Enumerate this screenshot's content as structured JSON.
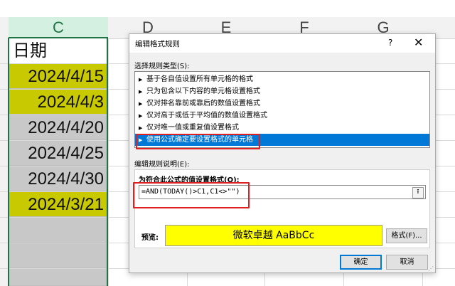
{
  "spreadsheet": {
    "columns": [
      "C",
      "D",
      "E",
      "F",
      "G"
    ],
    "header_cell": "日期",
    "dates": [
      {
        "text": "2024/4/15",
        "fill": "yellow"
      },
      {
        "text": "2024/4/3",
        "fill": "yellow"
      },
      {
        "text": "2024/4/20",
        "fill": "grey"
      },
      {
        "text": "2024/4/25",
        "fill": "grey"
      },
      {
        "text": "2024/4/30",
        "fill": "grey"
      },
      {
        "text": "2024/3/21",
        "fill": "yellow"
      }
    ]
  },
  "dialog": {
    "title": "编辑格式规则",
    "help": "?",
    "close": "✕",
    "rule_type_label": "选择规则类型(S):",
    "rule_types": [
      "基于各自值设置所有单元格的格式",
      "只为包含以下内容的单元格设置格式",
      "仅对排名靠前或靠后的数值设置格式",
      "仅对高于或低于平均值的数值设置格式",
      "仅对唯一值或重复值设置格式",
      "使用公式确定要设置格式的单元格"
    ],
    "selected_rule_index": 5,
    "description_label": "编辑规则说明(E):",
    "formula_label": "为符合此公式的值设置格式(O):",
    "formula_value": "=AND(TODAY()>C1,C1<>\"\")",
    "preview_label": "预览:",
    "preview_text": "微软卓越  AaBbCc",
    "format_button": "格式(F)...",
    "ok_button": "确定",
    "cancel_button": "取消"
  },
  "colors": {
    "yellow_fill": "#c9c900",
    "grey_fill": "#c8c8c8",
    "selection_blue": "#0078d7",
    "highlight_red": "#e02020",
    "preview_yellow": "#ffff00",
    "excel_green": "#217346"
  },
  "icons": {
    "expand_arrow": "▶",
    "collapse_dialog": "⭱",
    "resize_grip": "⋰"
  }
}
